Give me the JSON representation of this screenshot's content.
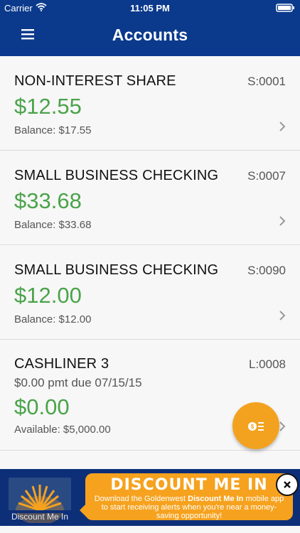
{
  "status_bar": {
    "carrier": "Carrier",
    "time": "11:05 PM"
  },
  "nav": {
    "title": "Accounts"
  },
  "accounts": [
    {
      "name": "NON-INTEREST SHARE",
      "code": "S:0001",
      "amount": "$12.55",
      "detail": "Balance: $17.55"
    },
    {
      "name": "SMALL BUSINESS CHECKING",
      "code": "S:0007",
      "amount": "$33.68",
      "detail": "Balance: $33.68"
    },
    {
      "name": "SMALL BUSINESS CHECKING",
      "code": "S:0090",
      "amount": "$12.00",
      "detail": "Balance: $12.00"
    },
    {
      "name": "CASHLINER 3",
      "code": "L:0008",
      "payment_due": "$0.00 pmt due 07/15/15",
      "amount": "$0.00",
      "detail": "Available: $5,000.00"
    }
  ],
  "ad": {
    "logo_text": "Discount Me In",
    "headline": "DISCOUNT ME IN",
    "body_pre": "Download the Goldenwest ",
    "body_bold": "Discount Me In",
    "body_post": " mobile app to start receiving alerts when you're near a money-saving opportunity!"
  },
  "colors": {
    "nav_bg": "#0b3a8c",
    "amount_green": "#4aa34a",
    "fab_orange": "#f3a21f",
    "ad_bg": "#0d2f78",
    "ad_bubble": "#f6a21e"
  }
}
